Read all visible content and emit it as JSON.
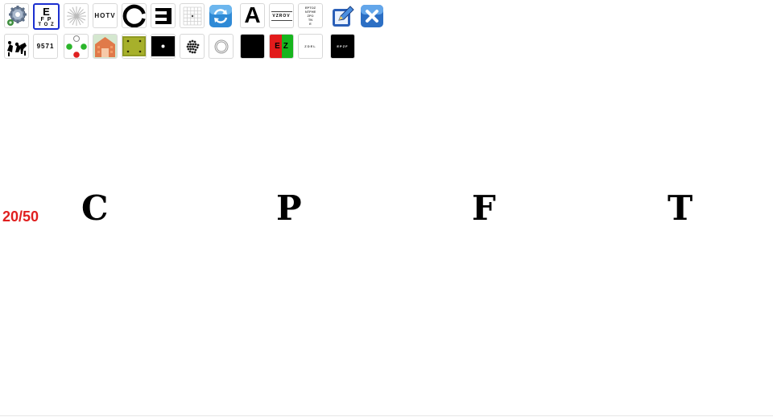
{
  "toolbar": {
    "row1": [
      {
        "name": "settings-gear-icon"
      },
      {
        "name": "snellen-chart-icon",
        "lines": [
          "E",
          "F P",
          "T O Z"
        ]
      },
      {
        "name": "astigmatism-fan-icon"
      },
      {
        "name": "hotv-chart-icon",
        "text": "HOTV"
      },
      {
        "name": "landolt-c-icon"
      },
      {
        "name": "tumbling-e-icon"
      },
      {
        "name": "amsler-grid-icon"
      },
      {
        "name": "refresh-icon"
      },
      {
        "name": "letter-a-size-icon",
        "text": "A"
      },
      {
        "name": "line-chart-icon",
        "text": "VZROV"
      },
      {
        "name": "pyramid-chart-icon",
        "lines": [
          "EPTOZ",
          "NTFHE",
          "ZFO",
          "TN",
          "E"
        ]
      },
      {
        "name": "edit-icon"
      },
      {
        "name": "close-icon"
      }
    ],
    "row2": [
      {
        "name": "picture-chart-icon"
      },
      {
        "name": "number-chart-icon",
        "text": "9571"
      },
      {
        "name": "worth-4-dot-icon"
      },
      {
        "name": "house-target-icon"
      },
      {
        "name": "dot-field-icon"
      },
      {
        "name": "fixation-dot-icon"
      },
      {
        "name": "dot-cluster-icon"
      },
      {
        "name": "concentric-circle-icon"
      },
      {
        "name": "black-screen-icon"
      },
      {
        "name": "red-green-duochrome-icon",
        "text": "EZ"
      },
      {
        "name": "mini-line-icon",
        "text": "ZDEL"
      },
      {
        "name": "inverse-line-icon",
        "text": "EPZF"
      }
    ]
  },
  "chart": {
    "acuity": "20/50",
    "letters": [
      "C",
      "P",
      "F",
      "T"
    ]
  },
  "colors": {
    "acuity": "#e01f1f",
    "selected_border": "#1b2fd0"
  }
}
